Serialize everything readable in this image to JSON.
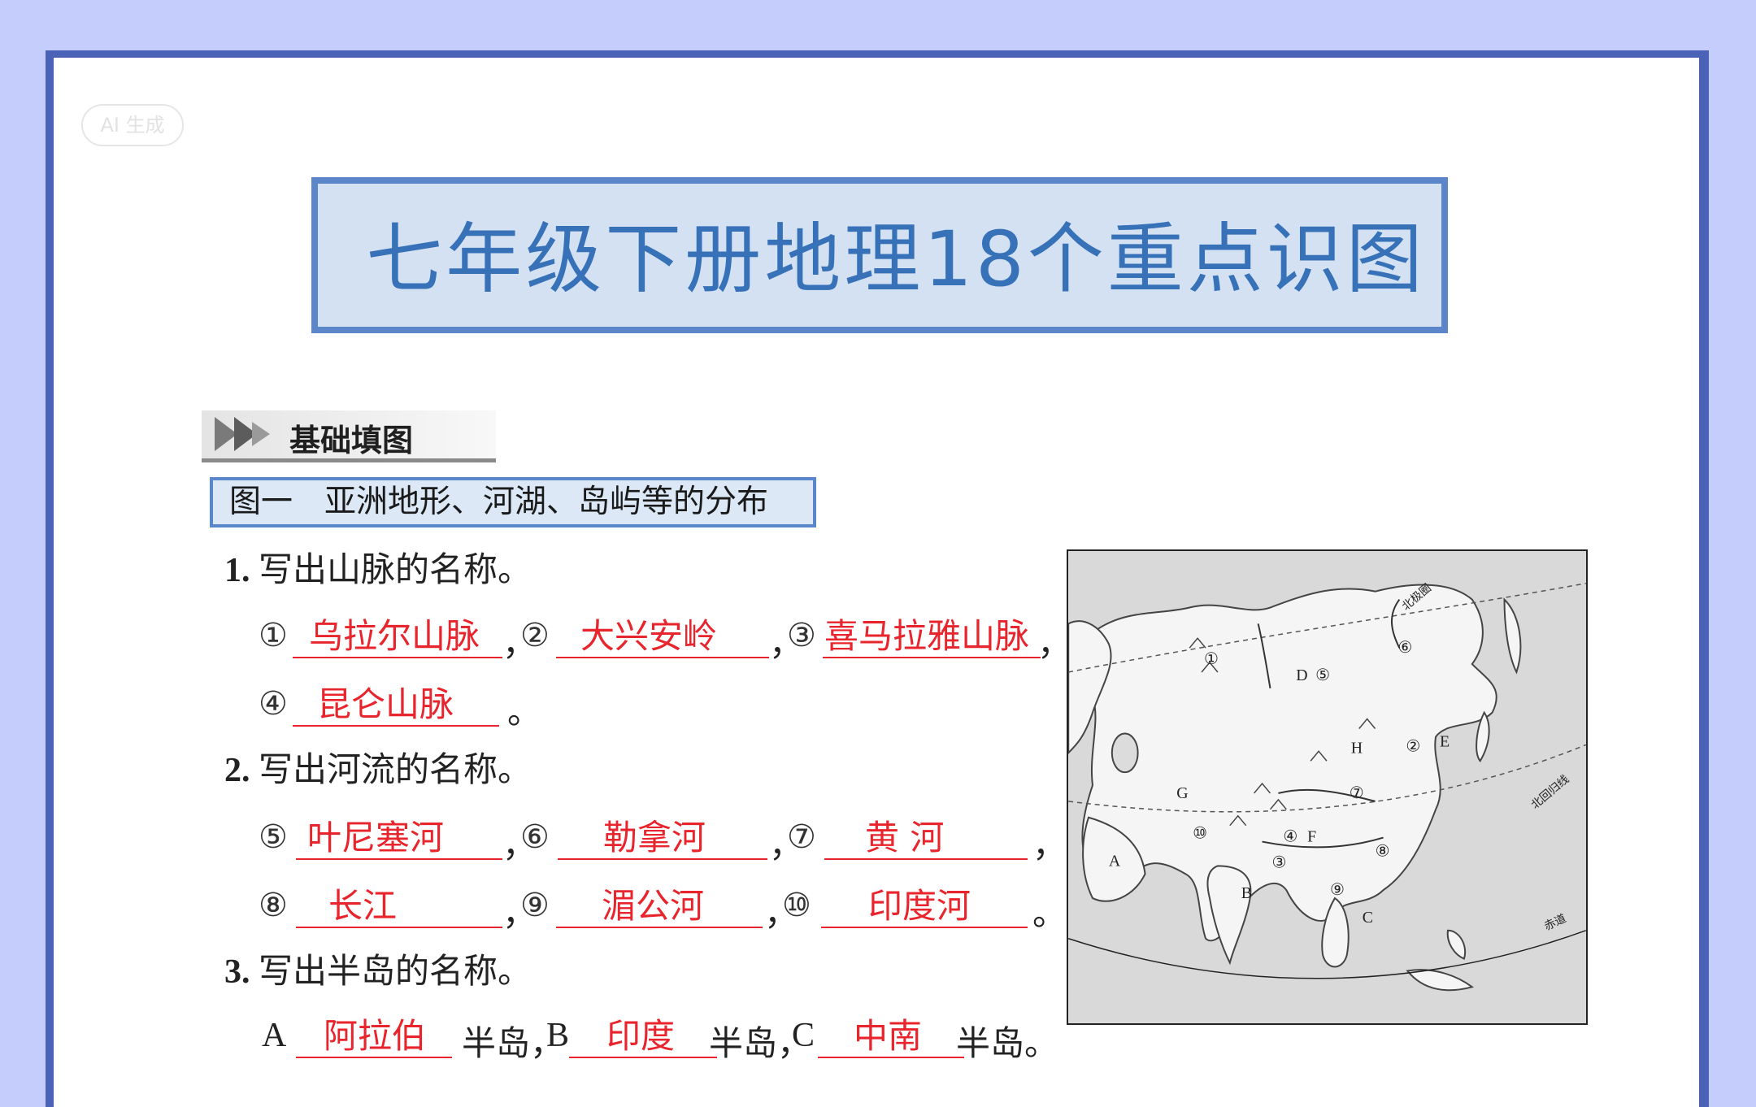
{
  "watermark": "AI 生成",
  "title": "七年级下册地理18个重点识图",
  "section": {
    "label": "基础填图"
  },
  "figure_title": "图一　亚洲地形、河湖、岛屿等的分布",
  "q1": {
    "num": "1.",
    "text": "写出山脉的名称。",
    "m1": "①",
    "a1": "乌拉尔山脉",
    "m2": "②",
    "a2": "大兴安岭",
    "m3": "③",
    "a3": "喜马拉雅山脉",
    "m4": "④",
    "a4": "昆仑山脉",
    "comma": "，",
    "period": "。"
  },
  "q2": {
    "num": "2.",
    "text": "写出河流的名称。",
    "m5": "⑤",
    "a5": "叶尼塞河",
    "m6": "⑥",
    "a6": "勒拿河",
    "m7": "⑦",
    "a7": "黄 河",
    "m8": "⑧",
    "a8": "长江",
    "m9": "⑨",
    "a9": "湄公河",
    "m10": "⑩",
    "a10": "印度河"
  },
  "q3": {
    "num": "3.",
    "text": "写出半岛的名称。",
    "la": "A",
    "aa": "阿拉伯",
    "suffix": "半岛",
    "lb": "B",
    "ab": "印度",
    "lc": "C",
    "ac": "中南"
  },
  "map": {
    "labels": [
      "①",
      "②",
      "③",
      "④",
      "⑤",
      "⑥",
      "⑦",
      "⑧",
      "⑨",
      "⑩",
      "A",
      "B",
      "C",
      "D",
      "E",
      "F",
      "G",
      "H"
    ],
    "arctic_circle": "北极圈",
    "tropic": "北回归线",
    "equator": "赤道"
  }
}
